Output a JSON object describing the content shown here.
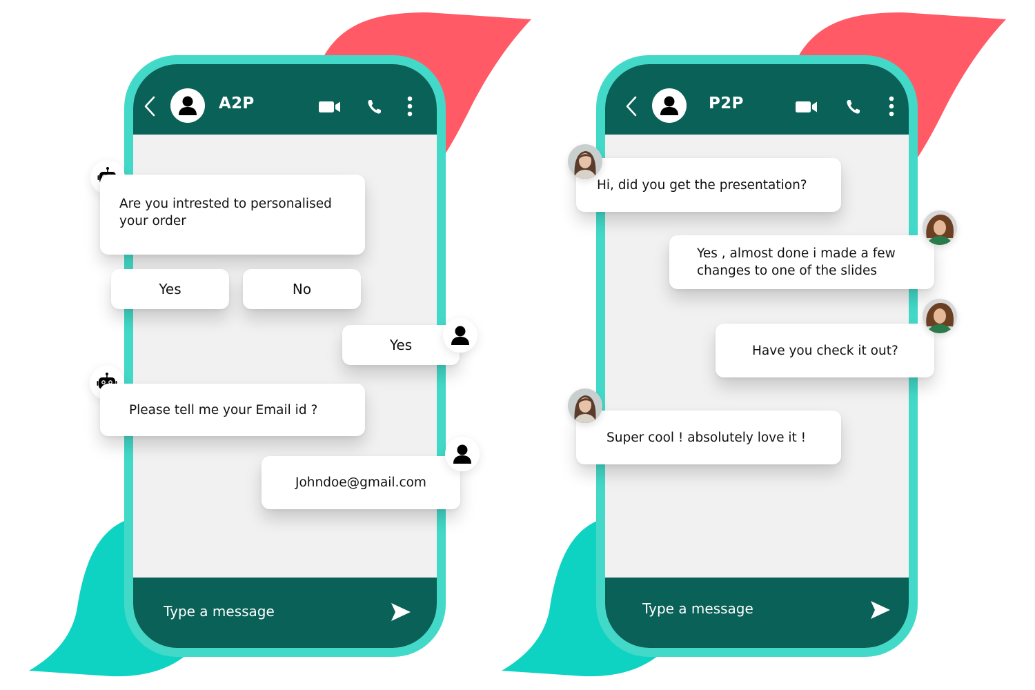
{
  "colors": {
    "frame": "#42d9c8",
    "header": "#0a6157",
    "chat_bg": "#f1f1f1",
    "accent_red": "#ff5a66",
    "accent_teal": "#0fd3c2"
  },
  "phones": [
    {
      "id": "a2p",
      "header": {
        "title": "A2P",
        "icons": [
          "back-icon",
          "user-avatar-icon",
          "video-call-icon",
          "phone-call-icon",
          "more-options-icon"
        ]
      },
      "messages": [
        {
          "sender": "bot",
          "avatar": "robot-icon",
          "text": "Are you intrested to personalised your order"
        },
        {
          "sender": "bot-options",
          "options": [
            "Yes",
            "No"
          ]
        },
        {
          "sender": "user",
          "avatar": "user-icon",
          "text": "Yes"
        },
        {
          "sender": "bot",
          "avatar": "robot-icon",
          "text": "Please tell me your Email id ?"
        },
        {
          "sender": "user",
          "avatar": "user-icon",
          "text": "Johndoe@gmail.com"
        }
      ],
      "footer": {
        "placeholder": "Type a message",
        "value": "",
        "send_icon": "send-icon"
      }
    },
    {
      "id": "p2p",
      "header": {
        "title": "P2P",
        "icons": [
          "back-icon",
          "user-avatar-icon",
          "video-call-icon",
          "phone-call-icon",
          "more-options-icon"
        ]
      },
      "messages": [
        {
          "sender": "contact",
          "avatar": "woman-photo-avatar",
          "text": "Hi, did you get the presentation?"
        },
        {
          "sender": "me",
          "avatar": "curly-hair-woman-photo-avatar",
          "text": "Yes , almost done i made a few changes to one of the slides"
        },
        {
          "sender": "me",
          "avatar": "curly-hair-woman-photo-avatar",
          "text": "Have you check it out?"
        },
        {
          "sender": "contact",
          "avatar": "woman-photo-avatar",
          "text": "Super cool ! absolutely love it !"
        }
      ],
      "footer": {
        "placeholder": "Type a message",
        "value": "",
        "send_icon": "send-icon"
      }
    }
  ]
}
